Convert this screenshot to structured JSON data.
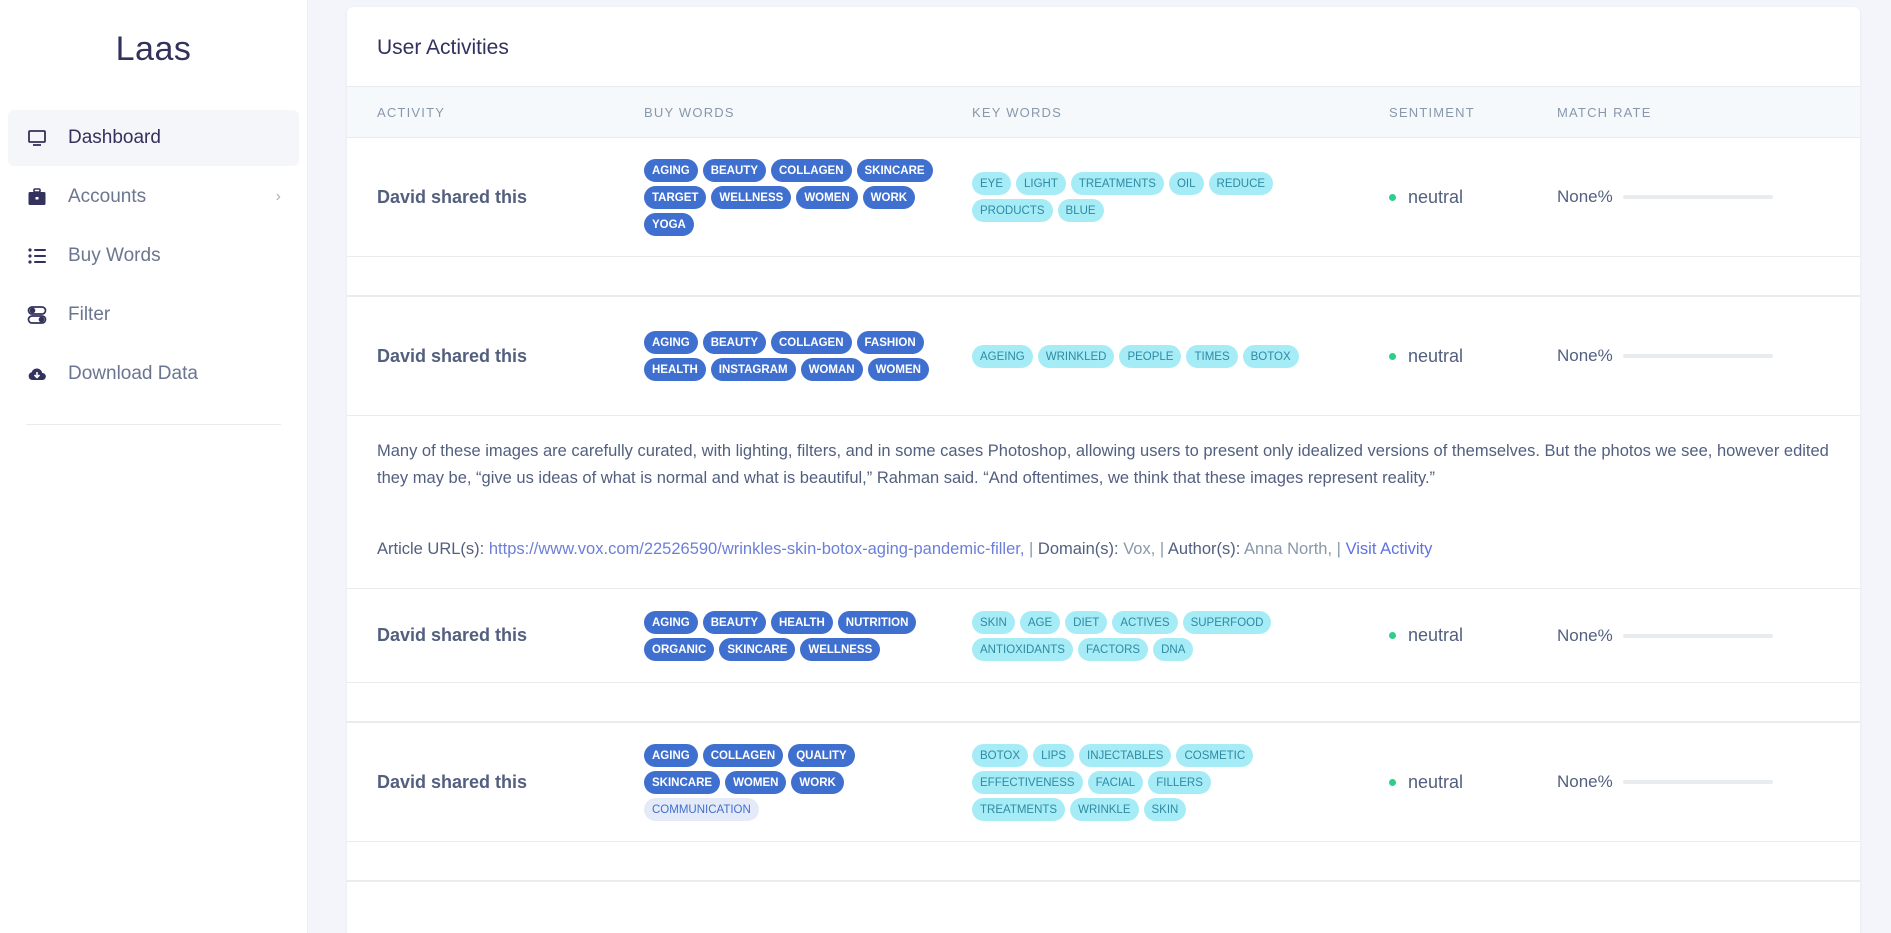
{
  "app": {
    "brand": "Laas"
  },
  "sidebar": {
    "items": [
      {
        "label": "Dashboard",
        "icon": "monitor-icon",
        "active": true
      },
      {
        "label": "Accounts",
        "icon": "briefcase-icon",
        "has_chevron": true
      },
      {
        "label": "Buy Words",
        "icon": "list-icon"
      },
      {
        "label": "Filter",
        "icon": "filter-icon"
      },
      {
        "label": "Download Data",
        "icon": "cloud-download-icon"
      }
    ]
  },
  "card": {
    "title": "User Activities",
    "columns": {
      "activity": "ACTIVITY",
      "buy_words": "BUY WORDS",
      "key_words": "KEY WORDS",
      "sentiment": "SENTIMENT",
      "match_rate": "MATCH RATE"
    }
  },
  "rows": [
    {
      "activity": "David shared this",
      "buy_words": [
        "AGING",
        "BEAUTY",
        "COLLAGEN",
        "SKINCARE",
        "TARGET",
        "WELLNESS",
        "WOMEN",
        "WORK",
        "YOGA"
      ],
      "key_words": [
        "EYE",
        "LIGHT",
        "TREATMENTS",
        "OIL",
        "REDUCE",
        "PRODUCTS",
        "BLUE"
      ],
      "sentiment": "neutral",
      "match_rate": "None%"
    },
    {
      "activity": "David shared this",
      "buy_words": [
        "AGING",
        "BEAUTY",
        "COLLAGEN",
        "FASHION",
        "HEALTH",
        "INSTAGRAM",
        "WOMAN",
        "WOMEN"
      ],
      "key_words": [
        "AGEING",
        "WRINKLED",
        "PEOPLE",
        "TIMES",
        "BOTOX"
      ],
      "sentiment": "neutral",
      "match_rate": "None%",
      "expanded": {
        "text": "Many of these images are carefully curated, with lighting, filters, and in some cases Photoshop, allowing users to present only idealized versions of themselves. But the photos we see, however edited they may be, “give us ideas of what is normal and what is beautiful,” Rahman said. “And oftentimes, we think that these images represent reality.”",
        "url_label": "Article URL(s):",
        "url": "https://www.vox.com/22526590/wrinkles-skin-botox-aging-pandemic-filler,",
        "domain_label": "Domain(s):",
        "domain": "Vox,",
        "author_label": "Author(s):",
        "author": "Anna North,",
        "visit_label": "Visit Activity",
        "separator": "|"
      }
    },
    {
      "activity": "David shared this",
      "buy_words": [
        "AGING",
        "BEAUTY",
        "HEALTH",
        "NUTRITION",
        "ORGANIC",
        "SKINCARE",
        "WELLNESS"
      ],
      "key_words": [
        "SKIN",
        "AGE",
        "DIET",
        "ACTIVES",
        "SUPERFOOD",
        "ANTIOXIDANTS",
        "FACTORS",
        "DNA"
      ],
      "sentiment": "neutral",
      "match_rate": "None%"
    },
    {
      "activity": "David shared this",
      "buy_words": [
        "AGING",
        "COLLAGEN",
        "QUALITY",
        "SKINCARE",
        "WOMEN",
        "WORK",
        "COMMUNICATION"
      ],
      "buy_words_light": [
        "COMMUNICATION"
      ],
      "key_words": [
        "BOTOX",
        "LIPS",
        "INJECTABLES",
        "COSMETIC",
        "EFFECTIVENESS",
        "FACIAL",
        "FILLERS",
        "TREATMENTS",
        "WRINKLE",
        "SKIN"
      ],
      "sentiment": "neutral",
      "match_rate": "None%"
    }
  ],
  "colors": {
    "buy_tag": "#3f6fcf",
    "key_tag": "#a6ecf7",
    "sentiment_dot": "#2dce89",
    "link": "#5e72e4"
  }
}
